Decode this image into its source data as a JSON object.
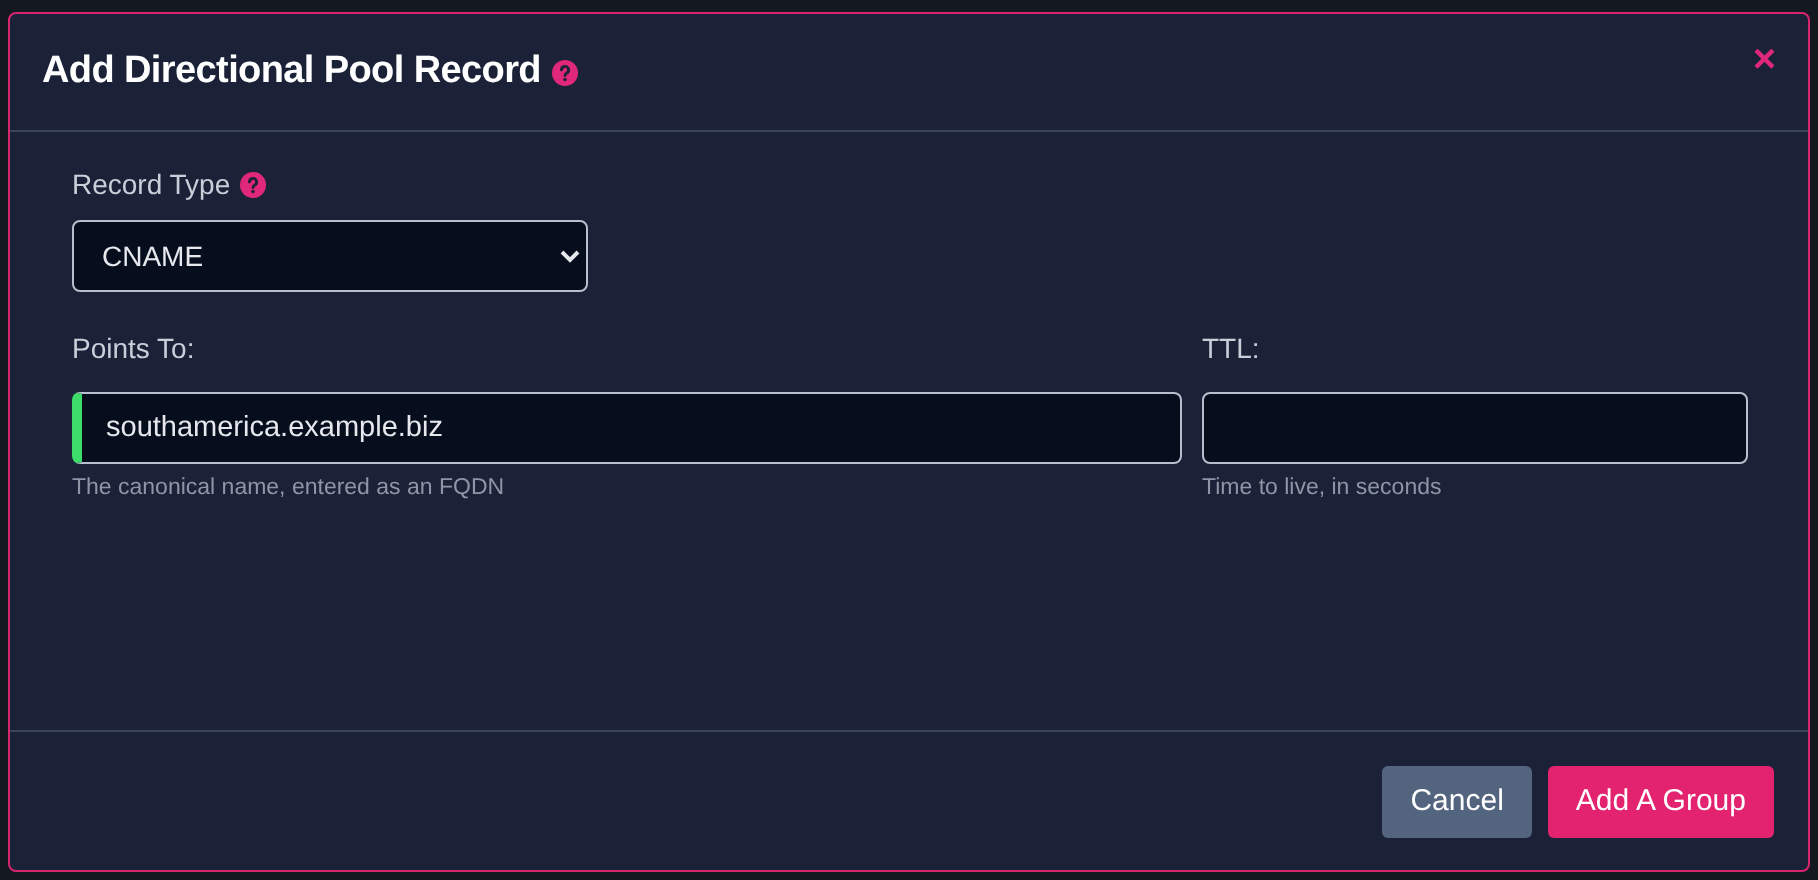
{
  "dialog": {
    "title": "Add Directional Pool Record",
    "close": "×"
  },
  "record_type": {
    "label": "Record Type",
    "value": "CNAME"
  },
  "fields": [
    {
      "label": "Points To:",
      "value": "southamerica.example.biz",
      "help": "The canonical name, entered as an FQDN",
      "valid": true,
      "wide": true
    },
    {
      "label": "TTL:",
      "help": "Time to live, in seconds",
      "valid": false,
      "wide": false
    }
  ],
  "buttons": [
    {
      "label": "Cancel",
      "kind": "secondary"
    },
    {
      "label": "Add A Group",
      "kind": "primary"
    }
  ]
}
